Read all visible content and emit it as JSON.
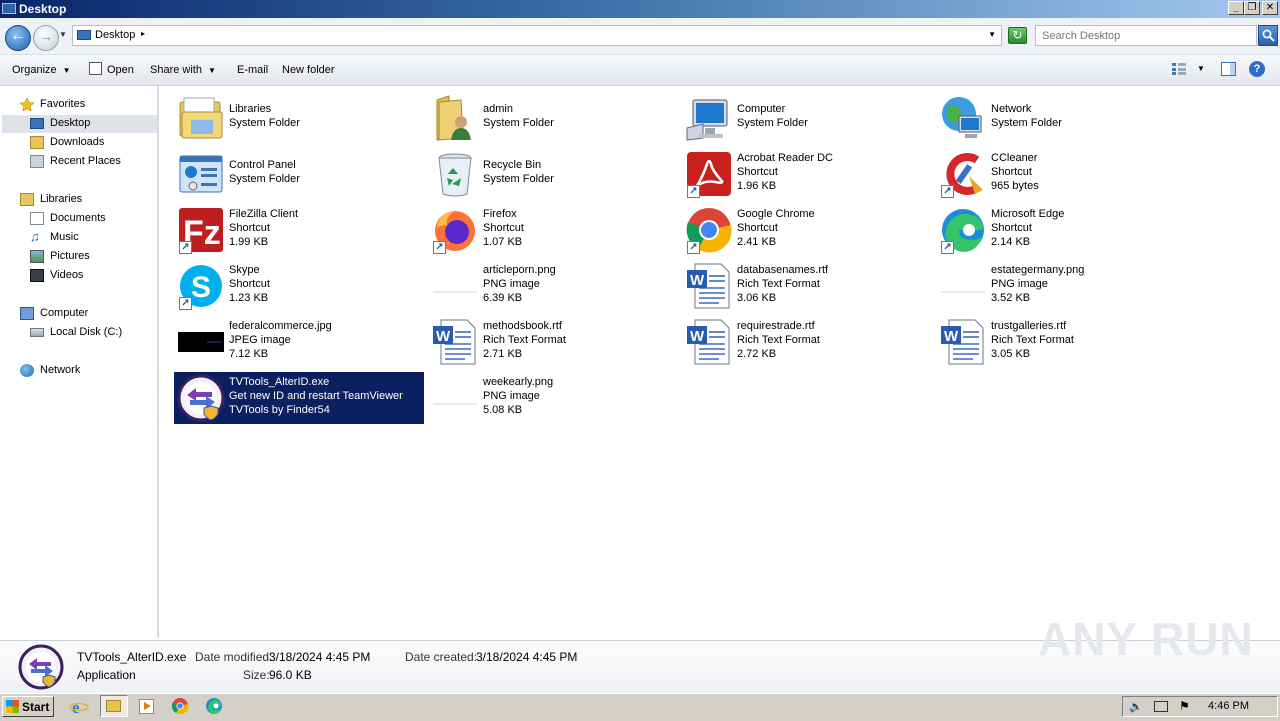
{
  "window": {
    "title": "Desktop"
  },
  "address": {
    "location": "Desktop",
    "search_placeholder": "Search Desktop"
  },
  "toolbar": {
    "organize": "Organize",
    "open": "Open",
    "share_with": "Share with",
    "email": "E-mail",
    "new_folder": "New folder"
  },
  "nav": {
    "favorites": "Favorites",
    "desktop": "Desktop",
    "downloads": "Downloads",
    "recent_places": "Recent Places",
    "libraries": "Libraries",
    "documents": "Documents",
    "music": "Music",
    "pictures": "Pictures",
    "videos": "Videos",
    "computer": "Computer",
    "local_disk": "Local Disk (C:)",
    "network": "Network"
  },
  "items": [
    {
      "name": "Libraries",
      "line2": "System Folder",
      "line3": "",
      "icon": "libraries-icon"
    },
    {
      "name": "admin",
      "line2": "System Folder",
      "line3": "",
      "icon": "user-folder-icon"
    },
    {
      "name": "Computer",
      "line2": "System Folder",
      "line3": "",
      "icon": "computer-icon"
    },
    {
      "name": "Network",
      "line2": "System Folder",
      "line3": "",
      "icon": "network-icon"
    },
    {
      "name": "Control Panel",
      "line2": "System Folder",
      "line3": "",
      "icon": "control-panel-icon"
    },
    {
      "name": "Recycle Bin",
      "line2": "System Folder",
      "line3": "",
      "icon": "recycle-bin-icon"
    },
    {
      "name": "Acrobat Reader DC",
      "line2": "Shortcut",
      "line3": "1.96 KB",
      "icon": "acrobat-icon"
    },
    {
      "name": "CCleaner",
      "line2": "Shortcut",
      "line3": "965 bytes",
      "icon": "ccleaner-icon"
    },
    {
      "name": "FileZilla Client",
      "line2": "Shortcut",
      "line3": "1.99 KB",
      "icon": "filezilla-icon"
    },
    {
      "name": "Firefox",
      "line2": "Shortcut",
      "line3": "1.07 KB",
      "icon": "firefox-icon"
    },
    {
      "name": "Google Chrome",
      "line2": "Shortcut",
      "line3": "2.41 KB",
      "icon": "chrome-icon"
    },
    {
      "name": "Microsoft Edge",
      "line2": "Shortcut",
      "line3": "2.14 KB",
      "icon": "edge-icon"
    },
    {
      "name": "Skype",
      "line2": "Shortcut",
      "line3": "1.23 KB",
      "icon": "skype-icon"
    },
    {
      "name": "articleporn.png",
      "line2": "PNG image",
      "line3": "6.39 KB",
      "icon": "png-file-icon"
    },
    {
      "name": "databasenames.rtf",
      "line2": "Rich Text Format",
      "line3": "3.06 KB",
      "icon": "rtf-file-icon"
    },
    {
      "name": "estategermany.png",
      "line2": "PNG image",
      "line3": "3.52 KB",
      "icon": "png-file-icon"
    },
    {
      "name": "federalcommerce.jpg",
      "line2": "JPEG image",
      "line3": "7.12 KB",
      "icon": "jpg-file-icon"
    },
    {
      "name": "methodsbook.rtf",
      "line2": "Rich Text Format",
      "line3": "2.71 KB",
      "icon": "rtf-file-icon"
    },
    {
      "name": "requirestrade.rtf",
      "line2": "Rich Text Format",
      "line3": "2.72 KB",
      "icon": "rtf-file-icon"
    },
    {
      "name": "trustgalleries.rtf",
      "line2": "Rich Text Format",
      "line3": "3.05 KB",
      "icon": "rtf-file-icon"
    },
    {
      "name": "TVTools_AlterID.exe",
      "line2": "Get new ID and restart TeamViewer",
      "line3": "TVTools by Finder54",
      "icon": "tvtools-icon"
    },
    {
      "name": "weekearly.png",
      "line2": "PNG image",
      "line3": "5.08 KB",
      "icon": "png-file-icon"
    }
  ],
  "details": {
    "filename": "TVTools_AlterID.exe",
    "type": "Application",
    "modified_label": "Date modified:",
    "modified_value": "3/18/2024 4:45 PM",
    "created_label": "Date created:",
    "created_value": "3/18/2024 4:45 PM",
    "size_label": "Size:",
    "size_value": "96.0 KB"
  },
  "taskbar": {
    "start": "Start",
    "clock": "4:46 PM"
  },
  "watermark": "ANY RUN",
  "colors": {
    "selection": "#0b2060",
    "title_bar": "#0a246a",
    "taskbar": "#d4d0c8"
  }
}
